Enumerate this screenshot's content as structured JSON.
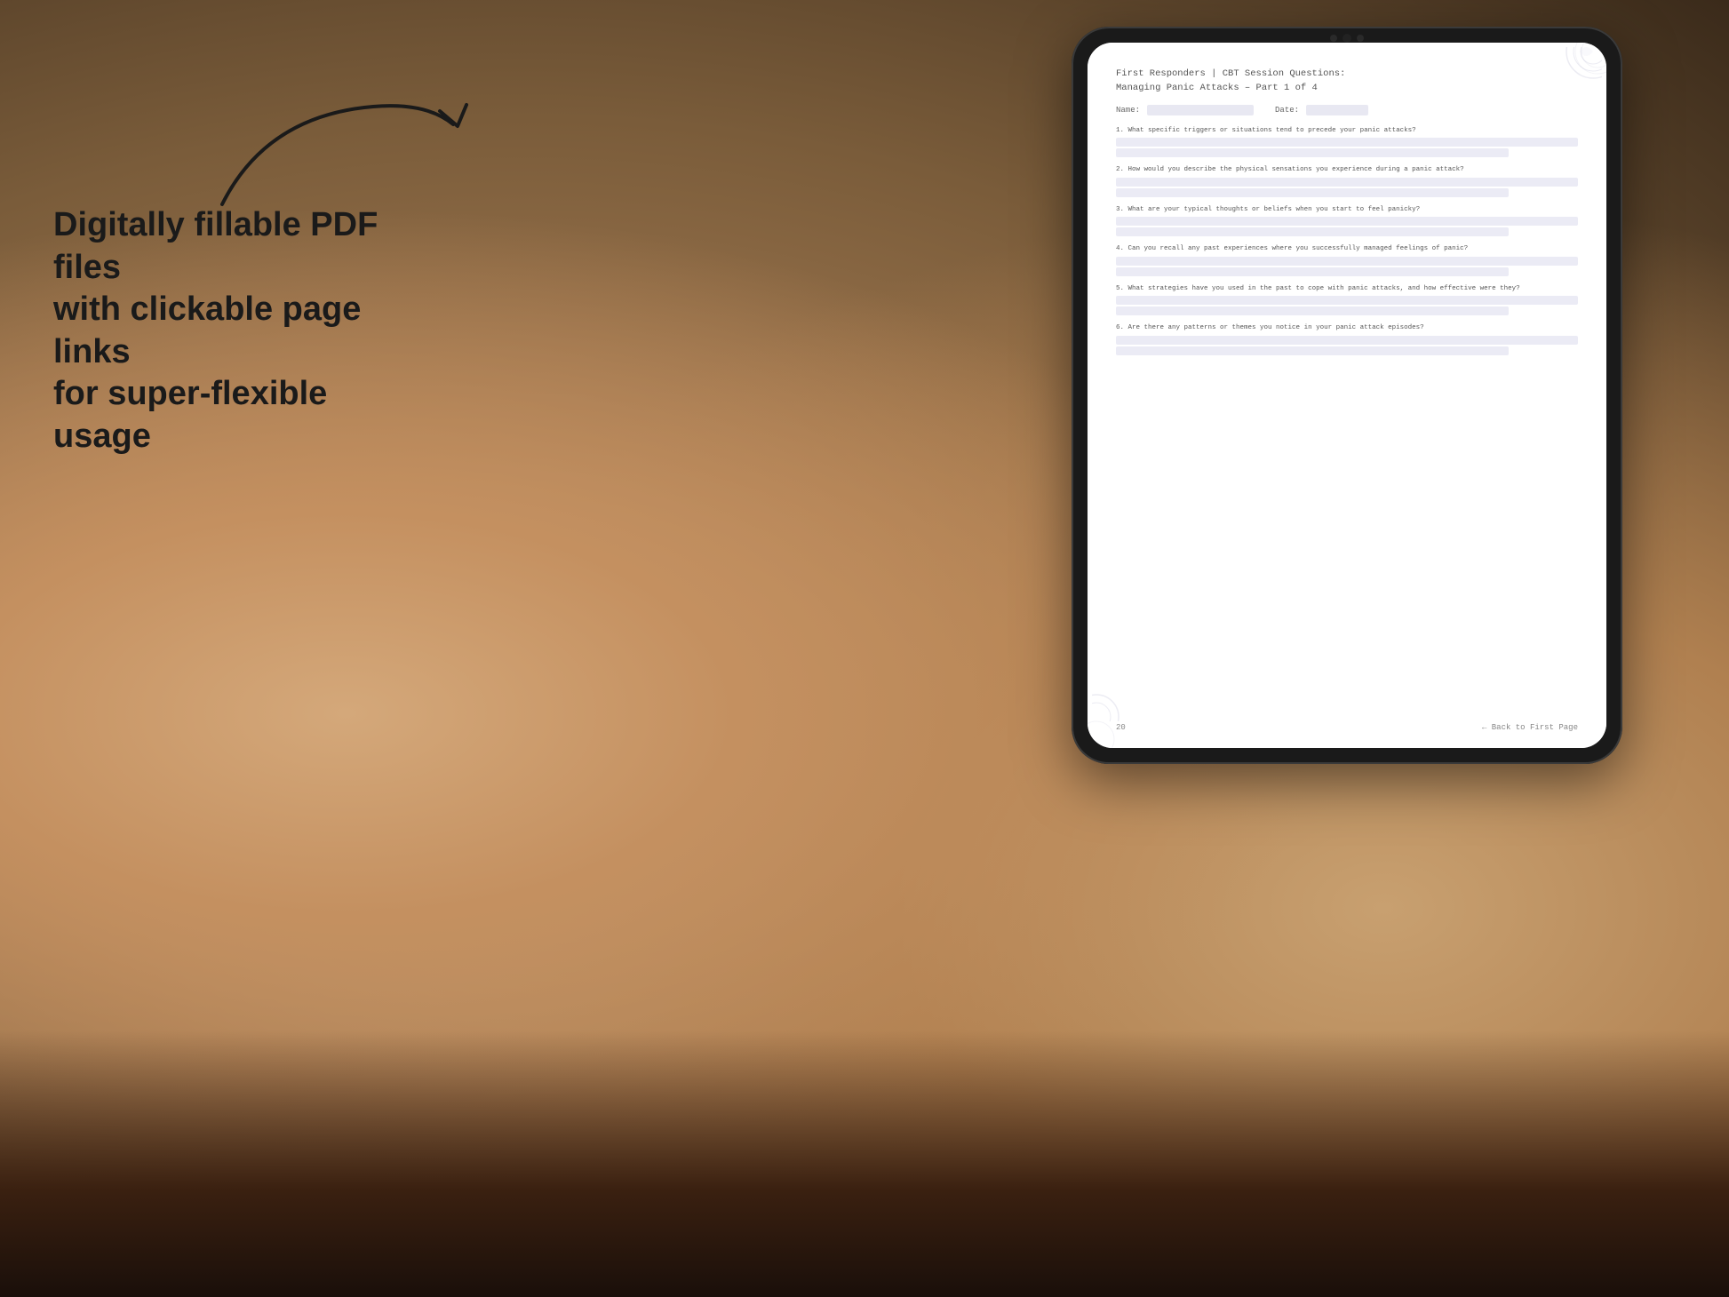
{
  "background": {
    "color_main": "#a08060"
  },
  "marketing": {
    "text": "Digitally fillable PDF files\nwith clickable page links\nfor super-flexible usage"
  },
  "tablet": {
    "pdf": {
      "title_line1": "First Responders | CBT Session Questions:",
      "title_line2": "Managing Panic Attacks – Part 1 of 4",
      "name_label": "Name:",
      "date_label": "Date:",
      "questions": [
        {
          "number": "1.",
          "text": "What specific triggers or situations tend to precede your panic attacks?"
        },
        {
          "number": "2.",
          "text": "How would you describe the physical sensations you experience during a panic attack?"
        },
        {
          "number": "3.",
          "text": "What are your typical thoughts or beliefs when you start to feel panicky?"
        },
        {
          "number": "4.",
          "text": "Can you recall any past experiences where you successfully managed feelings of panic?"
        },
        {
          "number": "5.",
          "text": "What strategies have you used in the past to cope with panic attacks, and how effective were they?"
        },
        {
          "number": "6.",
          "text": "Are there any patterns or themes you notice in your panic attack episodes?"
        }
      ],
      "footer": {
        "page_number": "20",
        "back_link": "← Back to First Page"
      }
    }
  }
}
